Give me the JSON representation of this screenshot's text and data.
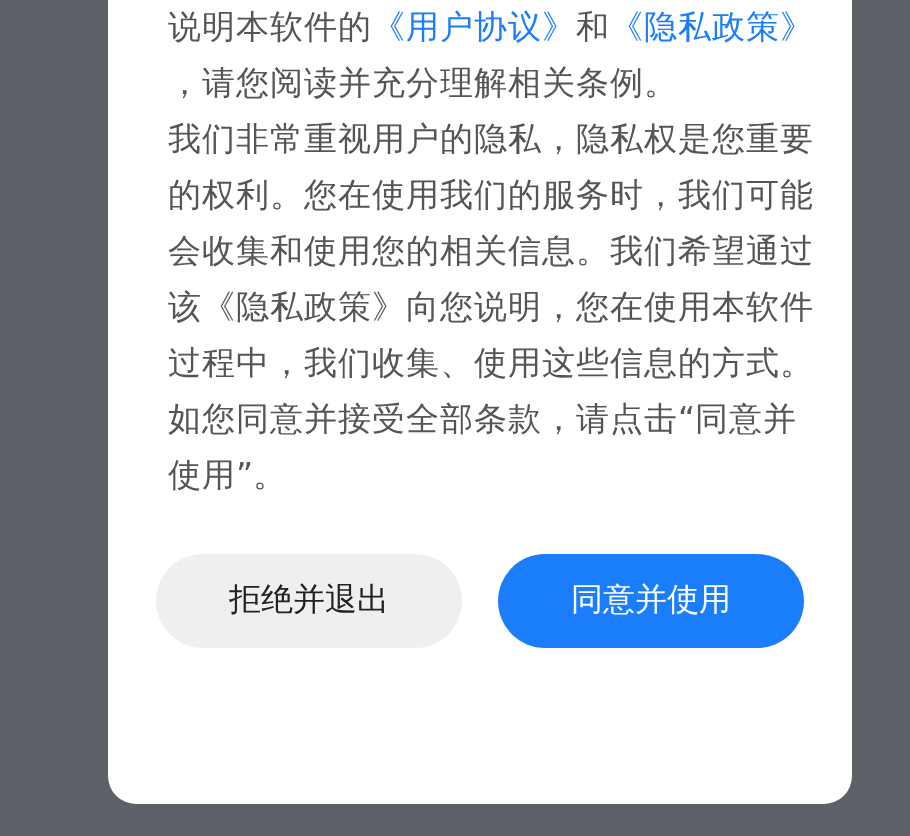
{
  "dialog": {
    "paragraphs": [
      {
        "parts": [
          {
            "kind": "text",
            "text": "说明本软件的"
          },
          {
            "kind": "link",
            "text": "《用户协议》"
          },
          {
            "kind": "text",
            "text": "和"
          },
          {
            "kind": "link",
            "text": "《隐私政策》"
          },
          {
            "kind": "text",
            "text": "，请您阅读并充分理解相关条例。"
          }
        ]
      },
      {
        "parts": [
          {
            "kind": "text",
            "text": "我们非常重视用户的隐私，隐私权是您重要的权利。您在使用我们的服务时，我们可能会收集和使用您的相关信息。我们希望通过该《隐私政策》向您说明，您在使用本软件过程中，我们收集、使用这些信息的方式。"
          }
        ]
      },
      {
        "parts": [
          {
            "kind": "text",
            "text": "如您同意并接受全部条款，请点击“同意并使用”。"
          }
        ]
      }
    ],
    "buttons": [
      {
        "label": "拒绝并退出",
        "kind": "secondary"
      },
      {
        "label": "同意并使用",
        "kind": "primary"
      }
    ]
  }
}
